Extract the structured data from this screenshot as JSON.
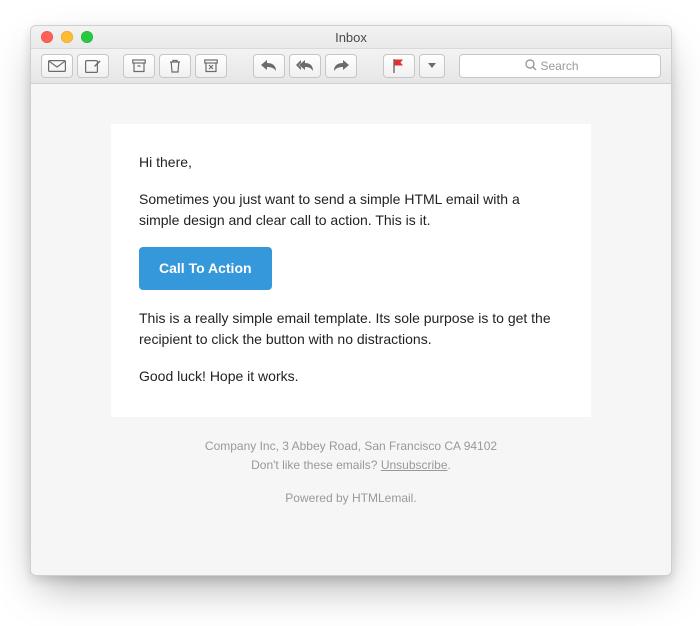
{
  "window": {
    "title": "Inbox"
  },
  "toolbar": {
    "search_placeholder": "Search"
  },
  "email": {
    "greeting": "Hi there,",
    "intro": "Sometimes you just want to send a simple HTML email with a simple design and clear call to action. This is it.",
    "cta_label": "Call To Action",
    "body2": "This is a really simple email template. Its sole purpose is to get the recipient to click the button with no distractions.",
    "signoff": "Good luck! Hope it works."
  },
  "footer": {
    "address": "Company Inc, 3 Abbey Road, San Francisco CA 94102",
    "dislike_prefix": "Don't like these emails? ",
    "unsubscribe_label": "Unsubscribe",
    "period": ".",
    "powered_by": "Powered by HTMLemail."
  },
  "colors": {
    "accent": "#3498db"
  }
}
